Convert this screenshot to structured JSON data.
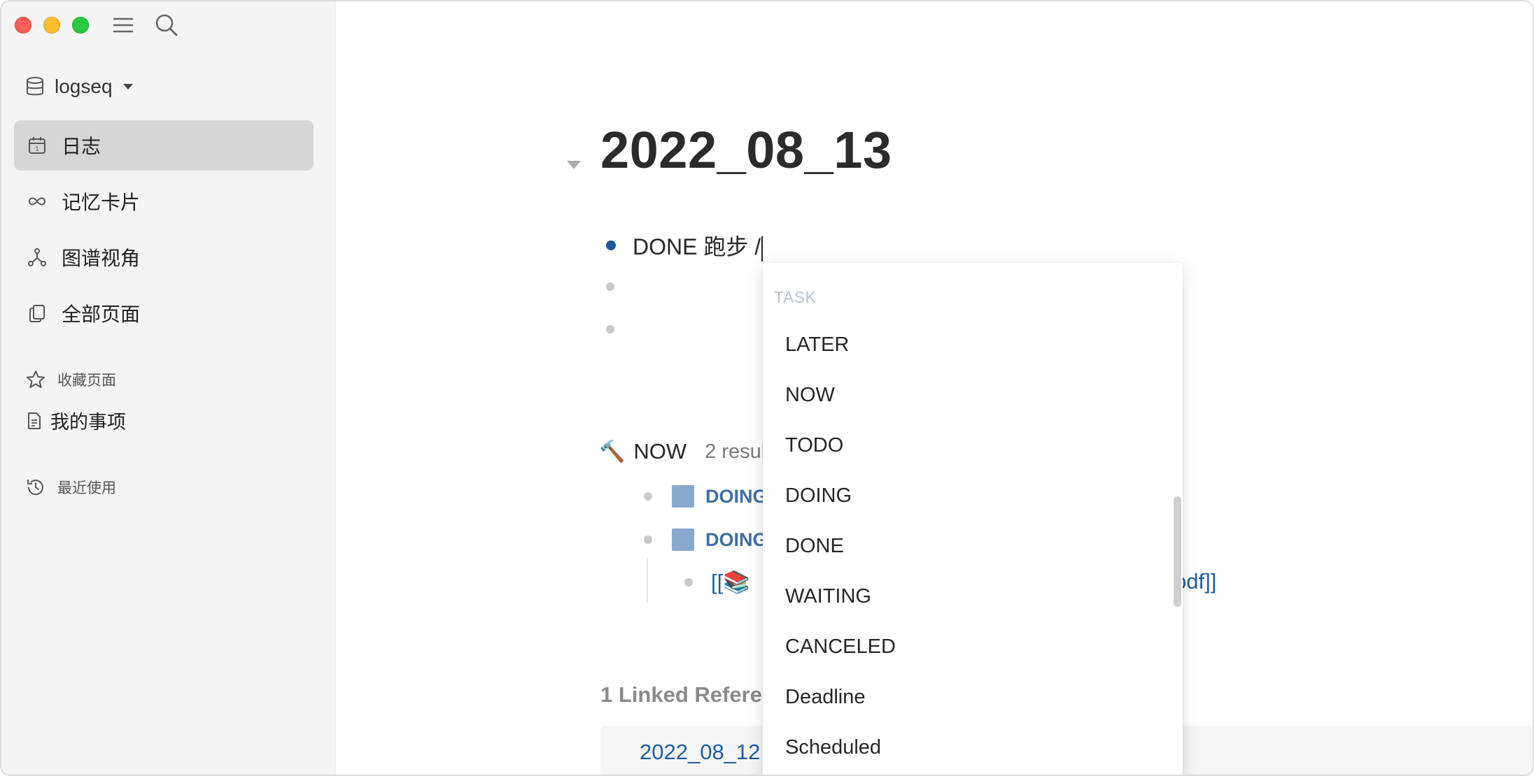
{
  "sidebar": {
    "graph_name": "logseq",
    "nav": [
      {
        "label": "日志",
        "icon": "calendar-icon"
      },
      {
        "label": "记忆卡片",
        "icon": "infinity-icon"
      },
      {
        "label": "图谱视角",
        "icon": "graph-icon"
      },
      {
        "label": "全部页面",
        "icon": "pages-icon"
      }
    ],
    "favorites_title": "收藏页面",
    "favorites": [
      {
        "label": "我的事项",
        "icon": "page-icon"
      }
    ],
    "recent_title": "最近使用"
  },
  "page": {
    "title": "2022_08_13",
    "blocks": [
      {
        "text": "DONE 跑步 /"
      },
      {
        "text": ""
      },
      {
        "text": ""
      }
    ]
  },
  "query": {
    "icon": "🔨",
    "title": "NOW",
    "count_text": "2 resul",
    "rows": [
      {
        "marker": "DOING"
      },
      {
        "marker": "DOING"
      }
    ],
    "child_ref_left": "[[📚",
    "child_ref_right": "pdf]]"
  },
  "linked": {
    "heading": "1 Linked Refere",
    "first_date": "2022_08_12"
  },
  "popup": {
    "group": "TASK",
    "items": [
      "LATER",
      "NOW",
      "TODO",
      "DOING",
      "DONE",
      "WAITING",
      "CANCELED",
      "Deadline",
      "Scheduled"
    ]
  },
  "colors": {
    "accent": "#1a5aa0",
    "link": "#1f5d9c",
    "sidebar_bg": "#f4f4f4",
    "active_nav": "#d6d6d6",
    "checkbox": "#8aa8cf"
  }
}
